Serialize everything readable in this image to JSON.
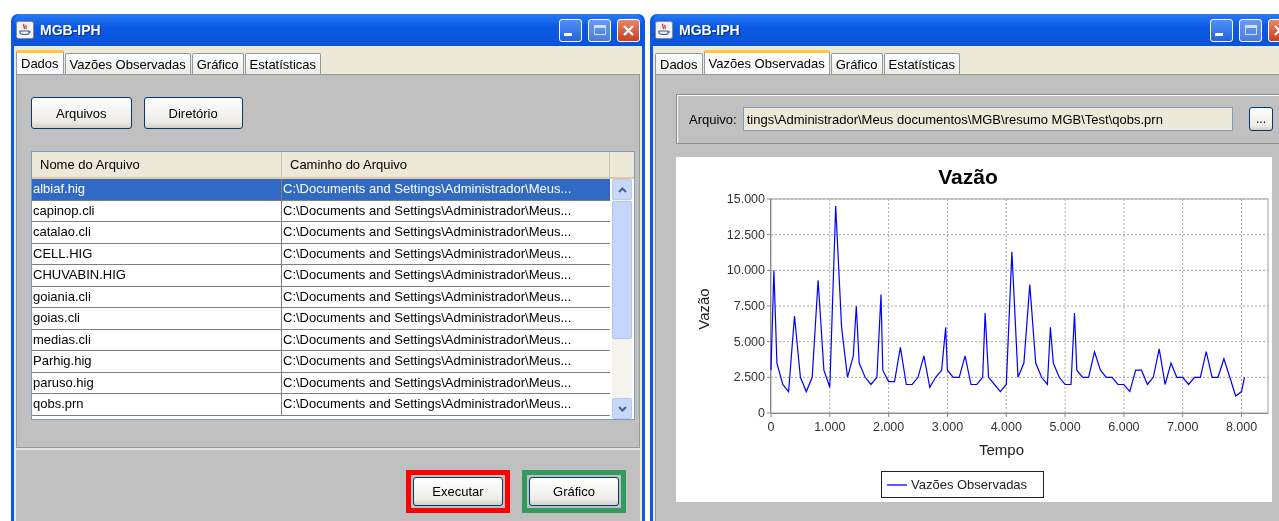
{
  "windows": [
    {
      "kind": "files",
      "title": "MGB-IPH",
      "tabs": [
        {
          "label": "Dados",
          "selected": true
        },
        {
          "label": "Vazões Observadas",
          "selected": false
        },
        {
          "label": "Gráfico",
          "selected": false
        },
        {
          "label": "Estatísticas",
          "selected": false
        }
      ],
      "top_buttons": [
        "Arquivos",
        "Diretório"
      ],
      "table": {
        "columns": [
          "Nome do Arquivo",
          "Caminho do Arquivo"
        ],
        "rows": [
          {
            "cells": [
              "albiaf.hig",
              "C:\\Documents and Settings\\Administrador\\Meus..."
            ],
            "selected": true
          },
          {
            "cells": [
              "capinop.cli",
              "C:\\Documents and Settings\\Administrador\\Meus..."
            ],
            "selected": false
          },
          {
            "cells": [
              "catalao.cli",
              "C:\\Documents and Settings\\Administrador\\Meus..."
            ],
            "selected": false
          },
          {
            "cells": [
              "CELL.HIG",
              "C:\\Documents and Settings\\Administrador\\Meus..."
            ],
            "selected": false
          },
          {
            "cells": [
              "CHUVABIN.HIG",
              "C:\\Documents and Settings\\Administrador\\Meus..."
            ],
            "selected": false
          },
          {
            "cells": [
              "goiania.cli",
              "C:\\Documents and Settings\\Administrador\\Meus..."
            ],
            "selected": false
          },
          {
            "cells": [
              "goias.cli",
              "C:\\Documents and Settings\\Administrador\\Meus..."
            ],
            "selected": false
          },
          {
            "cells": [
              "medias.cli",
              "C:\\Documents and Settings\\Administrador\\Meus..."
            ],
            "selected": false
          },
          {
            "cells": [
              "Parhig.hig",
              "C:\\Documents and Settings\\Administrador\\Meus..."
            ],
            "selected": false
          },
          {
            "cells": [
              "paruso.hig",
              "C:\\Documents and Settings\\Administrador\\Meus..."
            ],
            "selected": false
          },
          {
            "cells": [
              "qobs.prn",
              "C:\\Documents and Settings\\Administrador\\Meus..."
            ],
            "selected": false
          }
        ]
      },
      "bottom_buttons": [
        {
          "label": "Executar",
          "color": "#ff0000"
        },
        {
          "label": "Gráfico",
          "color": "#359a5e"
        }
      ]
    },
    {
      "kind": "chart",
      "title": "MGB-IPH",
      "tabs": [
        {
          "label": "Dados",
          "selected": false
        },
        {
          "label": "Vazões Observadas",
          "selected": true
        },
        {
          "label": "Gráfico",
          "selected": false
        },
        {
          "label": "Estatísticas",
          "selected": false
        }
      ],
      "file_field": {
        "label": "Arquivo:",
        "value": "tings\\Administrador\\Meus documentos\\MGB\\resumo MGB\\Test\\qobs.prn",
        "browse_button": "..."
      },
      "chart_data": {
        "type": "line",
        "grid": true,
        "title": "Vazão",
        "xlabel": "Tempo",
        "ylabel": "Vazão",
        "xlim": [
          0,
          8450
        ],
        "ylim": [
          0,
          15000
        ],
        "xticks": [
          {
            "value": 0,
            "label": "0"
          },
          {
            "value": 1000,
            "label": "1.000"
          },
          {
            "value": 2000,
            "label": "2.000"
          },
          {
            "value": 3000,
            "label": "3.000"
          },
          {
            "value": 4000,
            "label": "4.000"
          },
          {
            "value": 5000,
            "label": "5.000"
          },
          {
            "value": 6000,
            "label": "6.000"
          },
          {
            "value": 7000,
            "label": "7.000"
          },
          {
            "value": 8000,
            "label": "8.000"
          }
        ],
        "yticks": [
          {
            "value": 0,
            "label": "0"
          },
          {
            "value": 2500,
            "label": "2.500"
          },
          {
            "value": 5000,
            "label": "5.000"
          },
          {
            "value": 7500,
            "label": "7.500"
          },
          {
            "value": 10000,
            "label": "10.000"
          },
          {
            "value": 12500,
            "label": "12.500"
          },
          {
            "value": 15000,
            "label": "15.000"
          }
        ],
        "x": [
          0,
          50,
          100,
          200,
          300,
          400,
          500,
          600,
          700,
          800,
          900,
          1000,
          1100,
          1200,
          1300,
          1400,
          1450,
          1500,
          1600,
          1700,
          1800,
          1870,
          1900,
          2000,
          2100,
          2200,
          2300,
          2400,
          2500,
          2600,
          2700,
          2800,
          2900,
          2970,
          3000,
          3100,
          3200,
          3300,
          3400,
          3500,
          3600,
          3640,
          3700,
          3800,
          3900,
          4000,
          4095,
          4200,
          4300,
          4400,
          4500,
          4600,
          4700,
          4750,
          4800,
          4900,
          5000,
          5100,
          5160,
          5200,
          5300,
          5400,
          5500,
          5600,
          5700,
          5800,
          5900,
          6000,
          6100,
          6200,
          6300,
          6400,
          6500,
          6600,
          6700,
          6800,
          6900,
          7000,
          7100,
          7200,
          7300,
          7400,
          7500,
          7600,
          7700,
          7800,
          7900,
          8000,
          8050
        ],
        "series": [
          {
            "name": "Vazões Observadas",
            "color": "#0000ff",
            "values": [
              3000,
              10000,
              3500,
              2000,
              1500,
              6800,
              2500,
              1500,
              2500,
              9300,
              3000,
              1800,
              14500,
              6000,
              2500,
              4000,
              7500,
              3500,
              2500,
              2000,
              2500,
              8300,
              3000,
              2200,
              2200,
              4600,
              2000,
              2000,
              2500,
              4000,
              1800,
              2500,
              3000,
              6000,
              3000,
              2500,
              2500,
              4000,
              2000,
              2000,
              2500,
              7000,
              2500,
              2000,
              1500,
              2000,
              11300,
              2500,
              3500,
              9000,
              3500,
              2500,
              2000,
              6000,
              3500,
              2500,
              2000,
              2000,
              7000,
              3000,
              2500,
              2500,
              4300,
              3000,
              2500,
              2500,
              2000,
              2000,
              1500,
              3000,
              3000,
              2000,
              2500,
              4500,
              2000,
              3500,
              2500,
              2500,
              2000,
              2500,
              2500,
              4300,
              2500,
              2500,
              3800,
              2500,
              1200,
              1500,
              2500
            ]
          }
        ]
      }
    }
  ]
}
